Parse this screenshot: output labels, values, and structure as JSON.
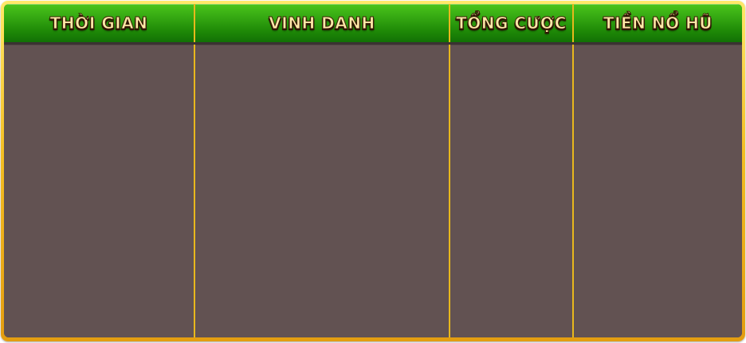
{
  "table": {
    "columns": [
      {
        "label": "THỜI GIAN"
      },
      {
        "label": "VINH DANH"
      },
      {
        "label": "TỔNG CƯỢC"
      },
      {
        "label": "TIỀN NỔ HŨ"
      }
    ],
    "rows": []
  },
  "colors": {
    "frame_gold": "#f2be23",
    "header_green": "#2a9a0c",
    "body_brown": "#625252",
    "divider_gold": "#e8b81c",
    "header_text": "#ffe9a8"
  }
}
